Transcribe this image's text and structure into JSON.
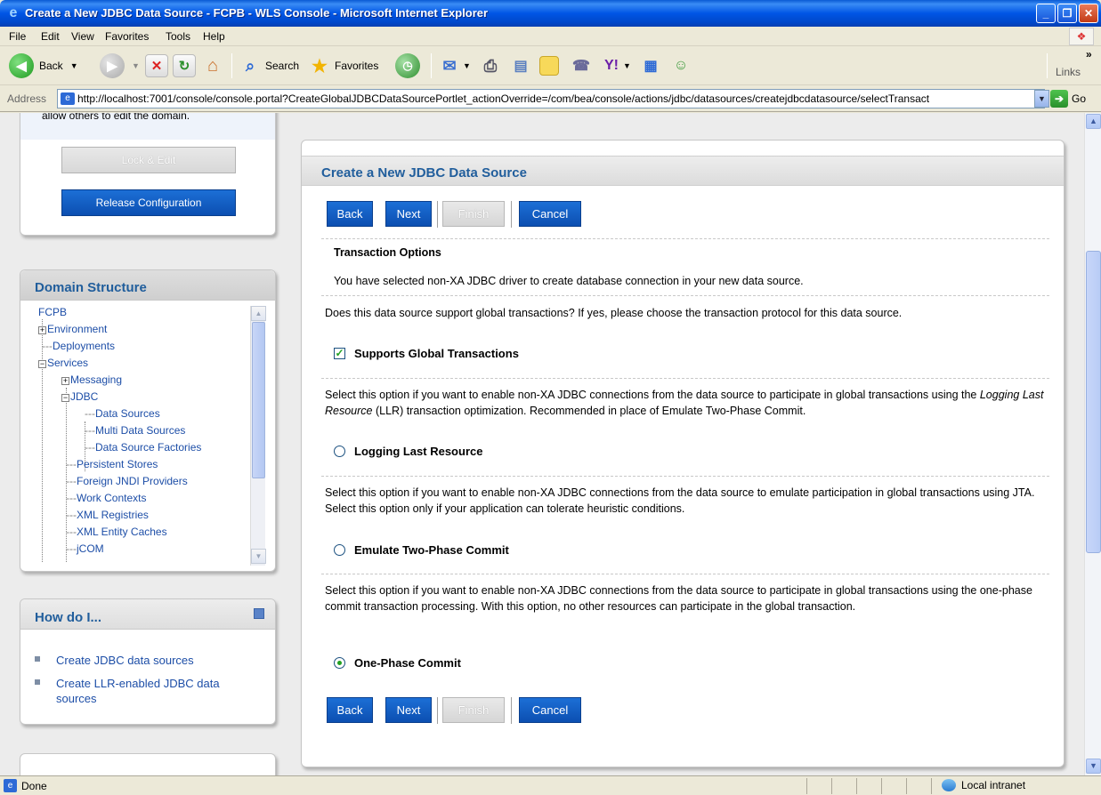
{
  "window": {
    "title": "Create a New JDBC Data Source - FCPB - WLS Console - Microsoft Internet Explorer",
    "min_glyph": "_",
    "max_glyph": "❐",
    "close_glyph": "✕"
  },
  "menu": [
    "File",
    "Edit",
    "View",
    "Favorites",
    "Tools",
    "Help"
  ],
  "toolbar": {
    "back_label": "Back",
    "search_label": "Search",
    "favorites_label": "Favorites",
    "links_label": "Links",
    "more_glyph": "»"
  },
  "address": {
    "label": "Address",
    "url": "http://localhost:7001/console/console.portal?CreateGlobalJDBCDataSourcePortlet_actionOverride=/com/bea/console/actions/jdbc/datasources/createjdbcdatasource/selectTransact",
    "go_label": "Go"
  },
  "change_center": {
    "partial_text": "allow others to edit the domain.",
    "lock_edit_label": "Lock & Edit",
    "release_label": "Release Configuration"
  },
  "domain_structure": {
    "title": "Domain Structure",
    "root": "FCPB",
    "environment": "Environment",
    "deployments": "Deployments",
    "services": "Services",
    "messaging": "Messaging",
    "jdbc": "JDBC",
    "data_sources": "Data Sources",
    "multi_data_sources": "Multi Data Sources",
    "data_source_factories": "Data Source Factories",
    "persistent_stores": "Persistent Stores",
    "foreign_jndi": "Foreign JNDI Providers",
    "work_contexts": "Work Contexts",
    "xml_registries": "XML Registries",
    "xml_entity_caches": "XML Entity Caches",
    "jcom": "jCOM"
  },
  "how_do_i": {
    "title": "How do I...",
    "items": [
      "Create JDBC data sources",
      "Create LLR-enabled JDBC data sources"
    ]
  },
  "main": {
    "title": "Create a New JDBC Data Source",
    "buttons": {
      "back": "Back",
      "next": "Next",
      "finish": "Finish",
      "cancel": "Cancel"
    },
    "section_title": "Transaction Options",
    "intro": "You have selected non-XA JDBC driver to create database connection in your new data source.",
    "question": "Does this data source support global transactions? If yes, please choose the transaction protocol for this data source.",
    "supports_global": "Supports Global Transactions",
    "llr_desc_1": "Select this option if you want to enable non-XA JDBC connections from the data source to participate in global transactions using the ",
    "llr_desc_em": "Logging Last Resource",
    "llr_desc_2": " (LLR) transaction optimization. Recommended in place of Emulate Two-Phase Commit.",
    "llr_label": "Logging Last Resource",
    "emulate_desc": "Select this option if you want to enable non-XA JDBC connections from the data source to emulate participation in global transactions using JTA. Select this option only if your application can tolerate heuristic conditions.",
    "emulate_label": "Emulate Two-Phase Commit",
    "onephase_desc": "Select this option if you want to enable non-XA JDBC connections from the data source to participate in global transactions using the one-phase commit transaction processing. With this option, no other resources can participate in the global transaction.",
    "onephase_label": "One-Phase Commit"
  },
  "status": {
    "text": "Done",
    "zone": "Local intranet"
  },
  "colors": {
    "xp_blue": "#0055e5",
    "header_text": "#215e9c",
    "button_blue": "#0c4fb1",
    "link": "#1d4ea7"
  }
}
